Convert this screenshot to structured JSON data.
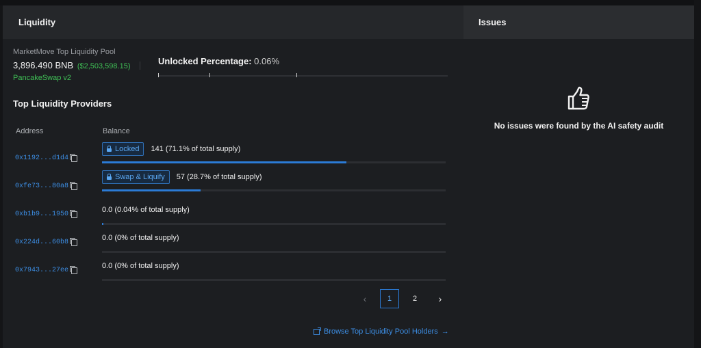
{
  "liquidity": {
    "title": "Liquidity",
    "pool": {
      "name": "MarketMove Top Liquidity Pool",
      "amount": "3,896.490 BNB",
      "usd": "($2,503,598.15)",
      "dex": "PancakeSwap v2"
    },
    "unlocked": {
      "label": "Unlocked Percentage:",
      "value": "0.06%"
    },
    "providers": {
      "title": "Top Liquidity Providers",
      "columns": {
        "address": "Address",
        "balance": "Balance"
      },
      "rows": [
        {
          "address": "0x1192...d1d4",
          "badge": "Locked",
          "balance": "141 (71.1% of total supply)",
          "share": 71.1
        },
        {
          "address": "0xfe73...80a8",
          "badge": "Swap & Liquify",
          "balance": "57 (28.7% of total supply)",
          "share": 28.7
        },
        {
          "address": "0xb1b9...1950",
          "badge": "",
          "balance": "0.0 (0.04% of total supply)",
          "share": 0.04
        },
        {
          "address": "0x224d...60b8",
          "badge": "",
          "balance": "0.0 (0% of total supply)",
          "share": 0
        },
        {
          "address": "0x7943...27ee",
          "badge": "",
          "balance": "0.0 (0% of total supply)",
          "share": 0
        }
      ]
    },
    "pagination": {
      "prev": "‹",
      "pages": [
        "1",
        "2"
      ],
      "current": "1",
      "next": "›"
    },
    "browse_link": "Browse Top Liquidity Pool Holders"
  },
  "issues": {
    "title": "Issues",
    "message": "No issues were found by the AI safety audit"
  },
  "colors": {
    "accent": "#2b7bd6",
    "positive": "#3fbf55",
    "panel": "#1c1e21",
    "header": "#25272a"
  }
}
